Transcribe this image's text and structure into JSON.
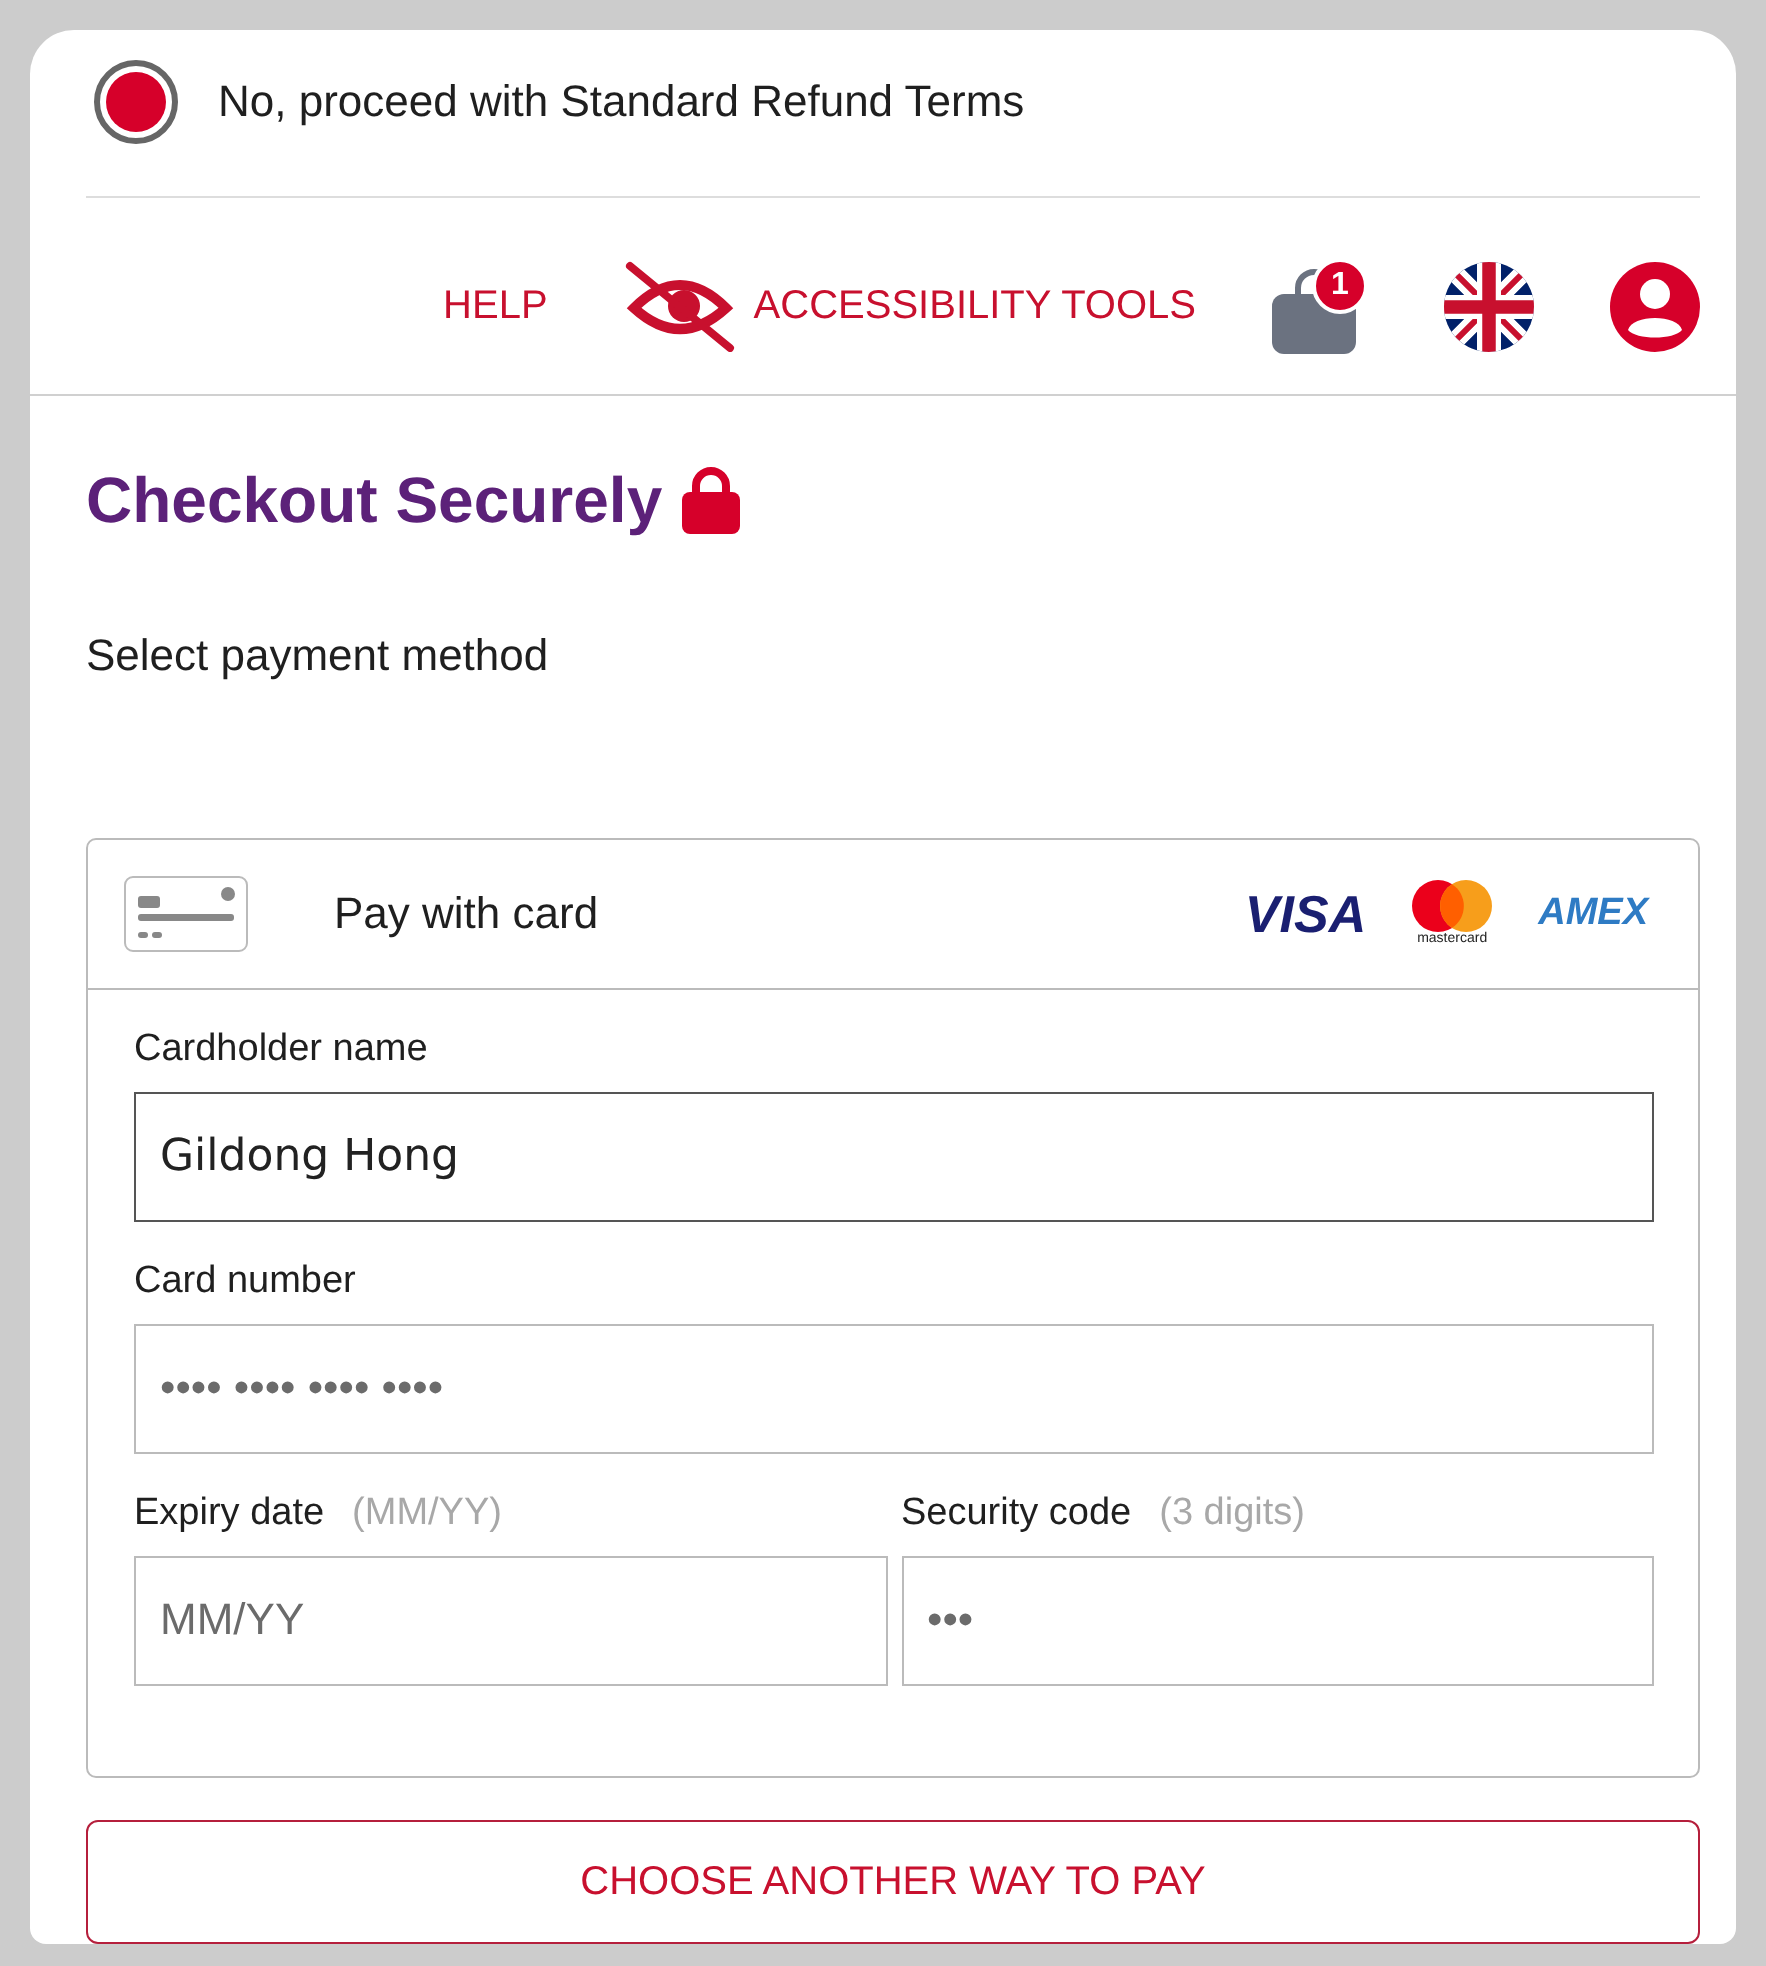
{
  "refund_option": {
    "label": "No, proceed with Standard Refund Terms",
    "selected": true
  },
  "nav": {
    "help": "HELP",
    "accessibility": "ACCESSIBILITY TOOLS",
    "cart_count": "1"
  },
  "checkout": {
    "title": "Checkout Securely",
    "subtitle": "Select payment method"
  },
  "payment_panel": {
    "title": "Pay with card",
    "card_brands": [
      {
        "kind": "visa",
        "label": "VISA"
      },
      {
        "kind": "mastercard",
        "label": "mastercard"
      },
      {
        "kind": "amex",
        "label": "AMEX"
      }
    ],
    "field_rows": [
      [
        {
          "label": "Cardholder name",
          "value": "Gildong Hong",
          "focused": true
        }
      ],
      [
        {
          "label": "Card number",
          "placeholder": "•••• •••• •••• ••••",
          "focused": false
        }
      ],
      [
        {
          "label": "Expiry date",
          "hint": "(MM/YY)",
          "placeholder": "MM/YY",
          "focused": false
        },
        {
          "label": "Security code",
          "hint": "(3 digits)",
          "placeholder": "•••",
          "focused": false
        }
      ]
    ]
  },
  "other_payment_button": {
    "label": "CHOOSE ANOTHER WAY TO PAY"
  }
}
